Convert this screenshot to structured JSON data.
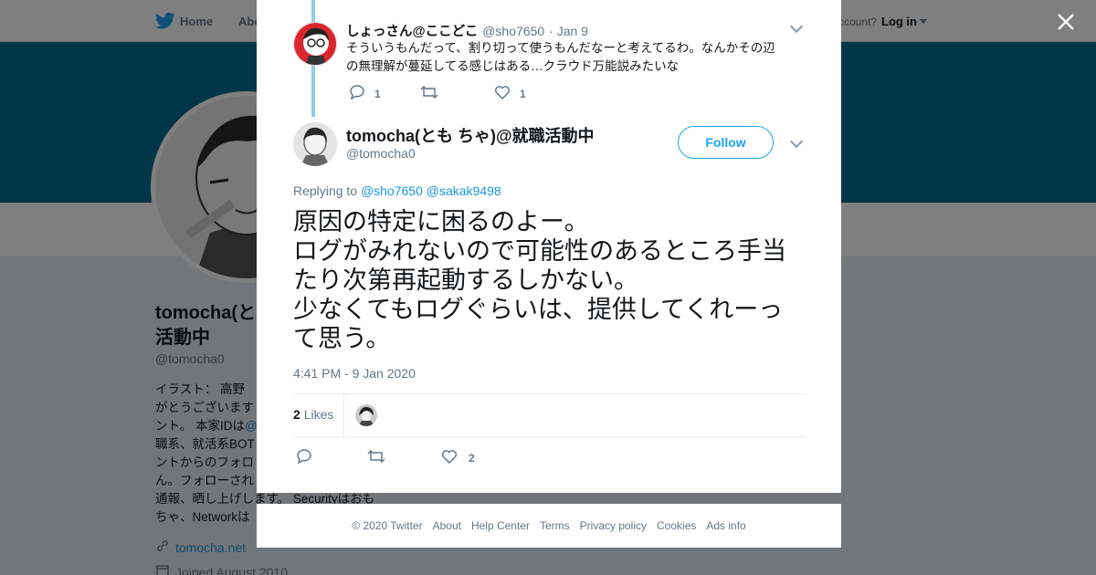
{
  "page": {
    "nav": {
      "home_label": "Home",
      "about_label": "Abo",
      "account_prompt": "ccount?",
      "login_label": "Log in"
    },
    "profile": {
      "name_line1": "tomocha(と",
      "name_line2": "活動中",
      "handle": "@tomocha0",
      "bio_lines": [
        "イラスト： 高野 ",
        "がとうございます",
        "ント。 本家IDは",
        "職系、就活系BOT",
        "ントからのフォロ",
        "ん。フォローされ",
        "通報、晒し上げします。 Securityはおも",
        "ちゃ、Networkは"
      ],
      "bio_link": "@",
      "website": "tomocha.net",
      "joined": "Joined August 2010"
    }
  },
  "modal": {
    "parent_tweet": {
      "name": "しょっさん@ここどこ",
      "handle": "@sho7650",
      "date": "· Jan 9",
      "text_line1": "そういうもんだって、割り切って使うもんだなーと考えてるわ。なんかその辺",
      "text_line2": "の無理解が蔓延してる感じはある…クラウド万能説みたいな",
      "replies": "1",
      "likes": "1"
    },
    "main_tweet": {
      "name": "tomocha(とも ちゃ)@就職活動中",
      "handle": "@tomocha0",
      "follow_label": "Follow",
      "replying_prefix": "Replying to",
      "replying_to_1": "@sho7650",
      "replying_to_2": "@sakak9498",
      "text": "原因の特定に困るのよー。\nログがみれないので可能性のあるところ手当たり次第再起動するしかない。\n少なくてもログぐらいは、提供してくれーって思う。",
      "timestamp": "4:41 PM - 9 Jan 2020",
      "like_count": "2",
      "likes_label": "Likes",
      "action_likes": "2"
    },
    "footer": [
      "© 2020 Twitter",
      "About",
      "Help Center",
      "Terms",
      "Privacy policy",
      "Cookies",
      "Ads info"
    ]
  },
  "colors": {
    "banner": "#006d8f",
    "link": "#1b95e0",
    "twitter_blue": "#1da1f2",
    "like_red": "#e0245e"
  },
  "icons": [
    "twitter-bird-icon",
    "close-icon",
    "reply-icon",
    "retweet-icon",
    "heart-icon",
    "chevron-down-icon",
    "link-icon",
    "calendar-icon"
  ]
}
